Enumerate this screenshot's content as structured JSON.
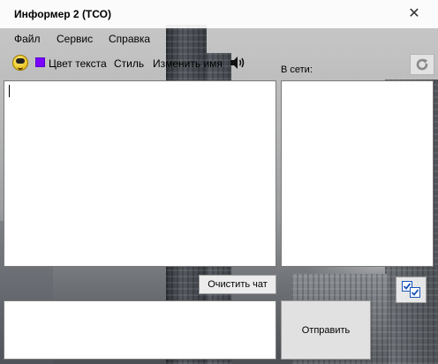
{
  "window": {
    "title": "Информер 2 (ТСО)",
    "close_glyph": "✕"
  },
  "menu": {
    "items": [
      {
        "label": "Файл"
      },
      {
        "label": "Сервис"
      },
      {
        "label": "Справка"
      }
    ]
  },
  "toolbar": {
    "emoji_icon": "smiley-icon",
    "text_color_swatch": "#7b00ff",
    "text_color_label": "Цвет текста",
    "style_label": "Стиль",
    "rename_label": "Изменить имя",
    "sound_icon": "speaker-icon",
    "refresh_icon": "refresh-icon"
  },
  "online": {
    "label": "В сети:"
  },
  "chat": {
    "clear_label": "Очистить чат",
    "send_label": "Отправить"
  }
}
